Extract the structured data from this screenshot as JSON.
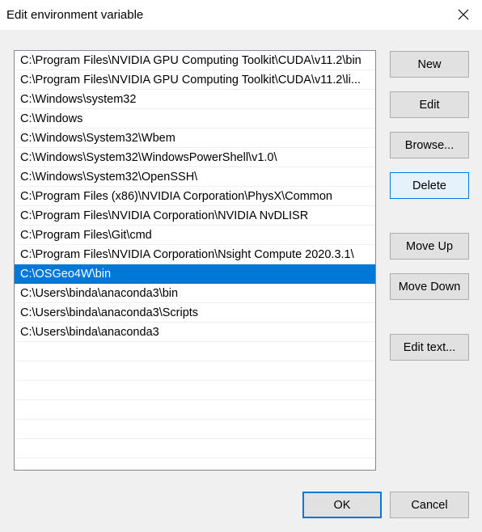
{
  "window": {
    "title": "Edit environment variable",
    "close_icon": "close-icon"
  },
  "list": {
    "items": [
      "C:\\Program Files\\NVIDIA GPU Computing Toolkit\\CUDA\\v11.2\\bin",
      "C:\\Program Files\\NVIDIA GPU Computing Toolkit\\CUDA\\v11.2\\li...",
      "C:\\Windows\\system32",
      "C:\\Windows",
      "C:\\Windows\\System32\\Wbem",
      "C:\\Windows\\System32\\WindowsPowerShell\\v1.0\\",
      "C:\\Windows\\System32\\OpenSSH\\",
      "C:\\Program Files (x86)\\NVIDIA Corporation\\PhysX\\Common",
      "C:\\Program Files\\NVIDIA Corporation\\NVIDIA NvDLISR",
      "C:\\Program Files\\Git\\cmd",
      "C:\\Program Files\\NVIDIA Corporation\\Nsight Compute 2020.3.1\\",
      "C:\\OSGeo4W\\bin",
      "C:\\Users\\binda\\anaconda3\\bin",
      "C:\\Users\\binda\\anaconda3\\Scripts",
      "C:\\Users\\binda\\anaconda3"
    ],
    "selected_index": 11,
    "selection_color": "#0078d7"
  },
  "buttons": {
    "new": "New",
    "edit": "Edit",
    "browse": "Browse...",
    "delete": "Delete",
    "move_up": "Move Up",
    "move_down": "Move Down",
    "edit_text": "Edit text...",
    "ok": "OK",
    "cancel": "Cancel"
  }
}
